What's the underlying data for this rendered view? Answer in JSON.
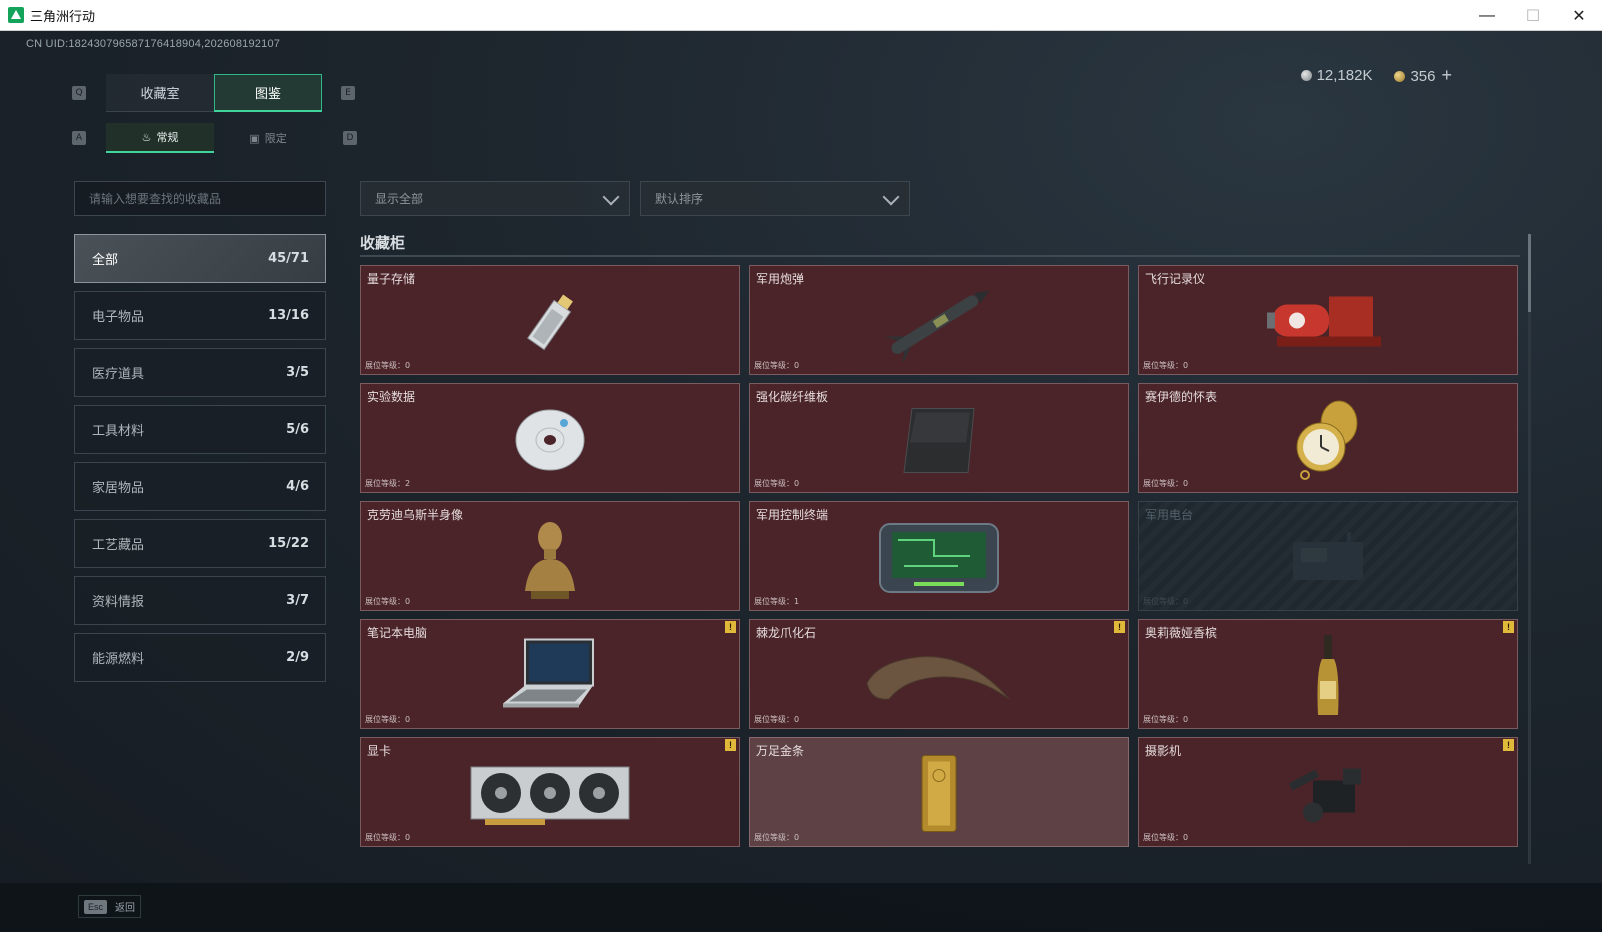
{
  "window": {
    "title": "三角洲行动"
  },
  "header": {
    "uid": "CN UID:18243079658717641890​4,202608192107",
    "silver": "12,182K",
    "gold": "356",
    "plus": "+"
  },
  "tabs": {
    "left_key": "Q",
    "right_key": "E",
    "items": [
      {
        "label": "收藏室"
      },
      {
        "label": "图鉴"
      }
    ]
  },
  "subtabs": {
    "left_key": "A",
    "right_key": "D",
    "items": [
      {
        "label": "常规"
      },
      {
        "label": "限定"
      }
    ]
  },
  "search": {
    "placeholder": "请输入想要查找的收藏品"
  },
  "filters": {
    "show": "显示全部",
    "sort": "默认排序"
  },
  "categories": [
    {
      "label": "全部",
      "count": "45/71"
    },
    {
      "label": "电子物品",
      "count": "13/16"
    },
    {
      "label": "医疗道具",
      "count": "3/5"
    },
    {
      "label": "工具材料",
      "count": "5/6"
    },
    {
      "label": "家居物品",
      "count": "4/6"
    },
    {
      "label": "工艺藏品",
      "count": "15/22"
    },
    {
      "label": "资料情报",
      "count": "3/7"
    },
    {
      "label": "能源燃料",
      "count": "2/9"
    }
  ],
  "cabinet": {
    "title": "收藏柜",
    "items": [
      {
        "name": "量子存储",
        "level": "展位等级：0",
        "icon": "usb-drive-icon"
      },
      {
        "name": "军用炮弹",
        "level": "展位等级：0",
        "icon": "missile-icon"
      },
      {
        "name": "飞行记录仪",
        "level": "展位等级：0",
        "icon": "flight-recorder-icon"
      },
      {
        "name": "实验数据",
        "level": "展位等级：2",
        "icon": "disc-icon"
      },
      {
        "name": "强化碳纤维板",
        "level": "展位等级：0",
        "icon": "carbon-plate-icon"
      },
      {
        "name": "赛伊德的怀表",
        "level": "展位等级：0",
        "icon": "pocket-watch-icon"
      },
      {
        "name": "克劳迪乌斯半身像",
        "level": "展位等级：0",
        "icon": "bust-icon"
      },
      {
        "name": "军用控制终端",
        "level": "展位等级：1",
        "icon": "control-terminal-icon"
      },
      {
        "name": "军用电台",
        "level": "展位等级：0",
        "icon": "radio-icon"
      },
      {
        "name": "笔记本电脑",
        "level": "展位等级：0",
        "icon": "laptop-icon",
        "badge": "!"
      },
      {
        "name": "棘龙爪化石",
        "level": "展位等级：0",
        "icon": "claw-fossil-icon",
        "badge": "!"
      },
      {
        "name": "奥莉薇娅香槟",
        "level": "展位等级：0",
        "icon": "champagne-icon",
        "badge": "!"
      },
      {
        "name": "显卡",
        "level": "展位等级：0",
        "icon": "graphics-card-icon",
        "badge": "!"
      },
      {
        "name": "万足金条",
        "level": "展位等级：0",
        "icon": "gold-bar-icon"
      },
      {
        "name": "摄影机",
        "level": "展位等级：0",
        "icon": "camera-icon",
        "badge": "!"
      }
    ]
  },
  "footer": {
    "esc_key": "Esc",
    "back_label": "返回"
  },
  "colors": {
    "accent": "#3fd59b",
    "card_bg": "#4a2429",
    "badge": "#e0b93a"
  }
}
